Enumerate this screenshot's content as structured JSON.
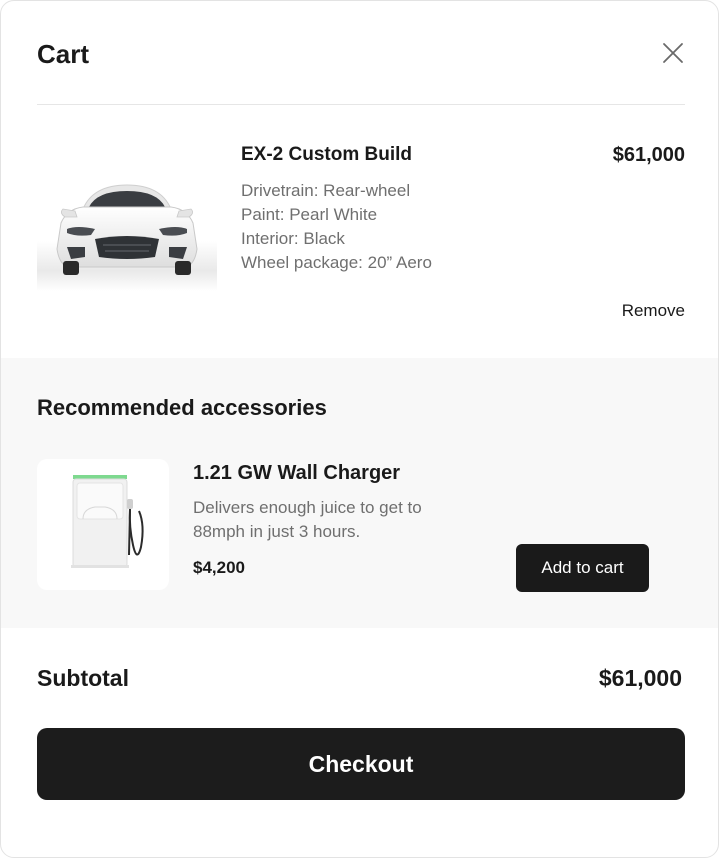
{
  "cart": {
    "title": "Cart",
    "close_icon": "close-icon"
  },
  "item": {
    "name": "EX-2 Custom Build",
    "price": "$61,000",
    "image_icon": "car-image",
    "specs": [
      "Drivetrain: Rear-wheel",
      "Paint: Pearl White",
      "Interior: Black",
      "Wheel package: 20” Aero"
    ],
    "remove_label": "Remove"
  },
  "recommended": {
    "title": "Recommended accessories",
    "accessory": {
      "name": "1.21 GW Wall Charger",
      "description": "Delivers enough juice to get to 88mph in just 3 hours.",
      "price": "$4,200",
      "image_icon": "wall-charger-image",
      "add_label": "Add to cart"
    }
  },
  "summary": {
    "subtotal_label": "Subtotal",
    "subtotal_value": "$61,000",
    "checkout_label": "Checkout"
  },
  "colors": {
    "primary": "#1c1c1c",
    "muted_text": "#6f6f6f",
    "section_bg": "#f8f8f8",
    "charger_accent": "#7ed98f"
  }
}
